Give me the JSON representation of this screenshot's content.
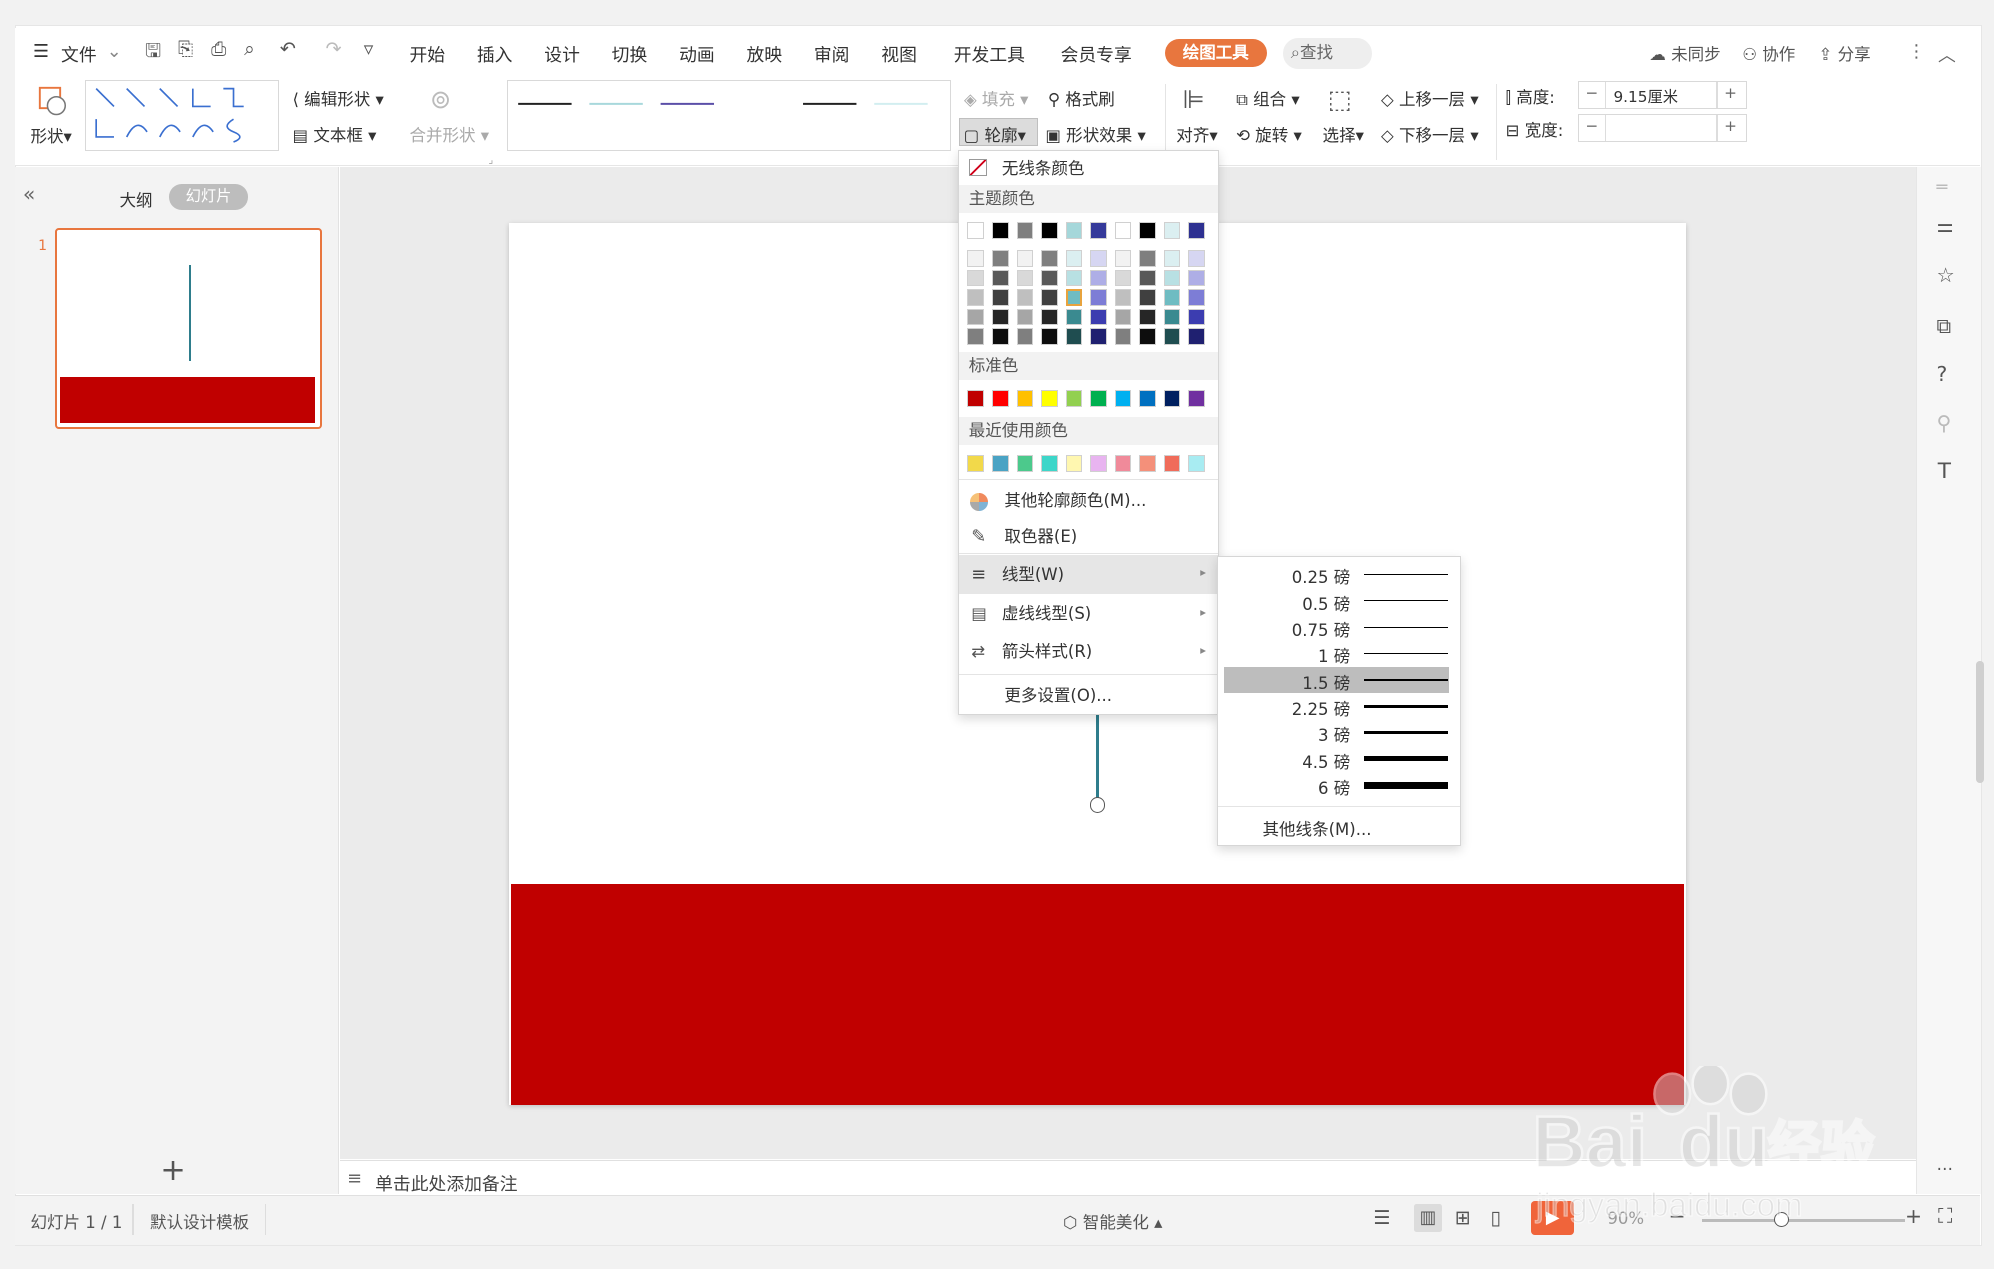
{
  "menubar": {
    "file": "文件",
    "tabs": [
      "开始",
      "插入",
      "设计",
      "切换",
      "动画",
      "放映",
      "审阅",
      "视图",
      "开发工具",
      "会员专享"
    ],
    "active_tab": "绘图工具",
    "search": "查找",
    "sync": "未同步",
    "collab": "协作",
    "share": "分享"
  },
  "ribbon": {
    "shape": "形状",
    "edit_shape": "编辑形状",
    "textbox": "文本框",
    "merge_shape": "合并形状",
    "fill": "填充",
    "format_painter": "格式刷",
    "outline": "轮廓",
    "shape_effect": "形状效果",
    "align": "对齐",
    "group": "组合",
    "rotate": "旋转",
    "select": "选择",
    "bring_forward": "上移一层",
    "send_backward": "下移一层",
    "height_label": "高度:",
    "height_value": "9.15厘米",
    "width_label": "宽度:",
    "width_value": "",
    "minus": "−",
    "plus": "+",
    "line_styles": [
      {
        "color": "#222222"
      },
      {
        "color": "#a8d8dc"
      },
      {
        "color": "#5b4fa8"
      },
      {
        "color": "#ffffff"
      },
      {
        "color": "#222222"
      },
      {
        "color": "#d2eef0"
      }
    ]
  },
  "left_panel": {
    "outline_tab": "大纲",
    "slides_tab": "幻灯片",
    "slide_number": "1",
    "add": "+"
  },
  "outline_menu": {
    "no_line": "无线条颜色",
    "theme_colors": "主题颜色",
    "standard_colors": "标准色",
    "recent_colors": "最近使用颜色",
    "more_colors": "其他轮廓颜色(M)...",
    "eyedropper": "取色器(E)",
    "line_type": "线型(W)",
    "dash_type": "虚线线型(S)",
    "arrow_style": "箭头样式(R)",
    "more_settings": "更多设置(O)...",
    "theme_top": [
      "#ffffff",
      "#000000",
      "#7f7f7f",
      "#000000",
      "#a5d7da",
      "#353a9a",
      "#ffffff",
      "#000000",
      "#dbeff1",
      "#2e3191"
    ],
    "theme_grid": [
      [
        "#f2f2f2",
        "#7f7f7f",
        "#f2f2f2",
        "#7f7f7f",
        "#dbeff1",
        "#d6d6f2",
        "#f2f2f2",
        "#7f7f7f",
        "#dbeff1",
        "#d6d6f2"
      ],
      [
        "#d9d9d9",
        "#595959",
        "#d9d9d9",
        "#595959",
        "#b8e0e3",
        "#aeaee6",
        "#d9d9d9",
        "#595959",
        "#b8e0e3",
        "#aeaee6"
      ],
      [
        "#bfbfbf",
        "#404040",
        "#bfbfbf",
        "#404040",
        "#6fbcc2",
        "#7d7dd6",
        "#bfbfbf",
        "#404040",
        "#6fbcc2",
        "#7d7dd6"
      ],
      [
        "#a6a6a6",
        "#262626",
        "#a6a6a6",
        "#262626",
        "#3a8a90",
        "#3c3db0",
        "#a6a6a6",
        "#262626",
        "#3a8a90",
        "#3c3db0"
      ],
      [
        "#7f7f7f",
        "#0d0d0d",
        "#7f7f7f",
        "#0d0d0d",
        "#1f4d50",
        "#1f2070",
        "#7f7f7f",
        "#0d0d0d",
        "#1f4d50",
        "#1f2070"
      ]
    ],
    "standard": [
      "#c00000",
      "#ff0000",
      "#ffc000",
      "#ffff00",
      "#92d050",
      "#00b050",
      "#00b0f0",
      "#0070c0",
      "#002060",
      "#7030a0"
    ],
    "recent": [
      "#f2d94a",
      "#4aa3c4",
      "#4cc98c",
      "#3dd6c9",
      "#fff7b0",
      "#e8b4f0",
      "#f08a9a",
      "#f4907a",
      "#f06c5a",
      "#a8ecf2"
    ]
  },
  "line_menu": {
    "weights": [
      {
        "label": "0.25 磅",
        "width": 0.5
      },
      {
        "label": "0.5 磅",
        "width": 0.8
      },
      {
        "label": "0.75 磅",
        "width": 1
      },
      {
        "label": "1 磅",
        "width": 1.3
      },
      {
        "label": "1.5 磅",
        "width": 2
      },
      {
        "label": "2.25 磅",
        "width": 2.5
      },
      {
        "label": "3 磅",
        "width": 3
      },
      {
        "label": "4.5 磅",
        "width": 4
      },
      {
        "label": "6 磅",
        "width": 5.5
      }
    ],
    "selected_index": 4,
    "more_lines": "其他线条(M)..."
  },
  "notes": {
    "placeholder": "单击此处添加备注"
  },
  "status": {
    "slide_count": "幻灯片 1 / 1",
    "template": "默认设计模板",
    "smart": "智能美化",
    "zoom": "90%"
  },
  "colors": {
    "accent": "#e8763e",
    "slide_red": "#c00000",
    "line_teal": "#2e7d8c"
  }
}
